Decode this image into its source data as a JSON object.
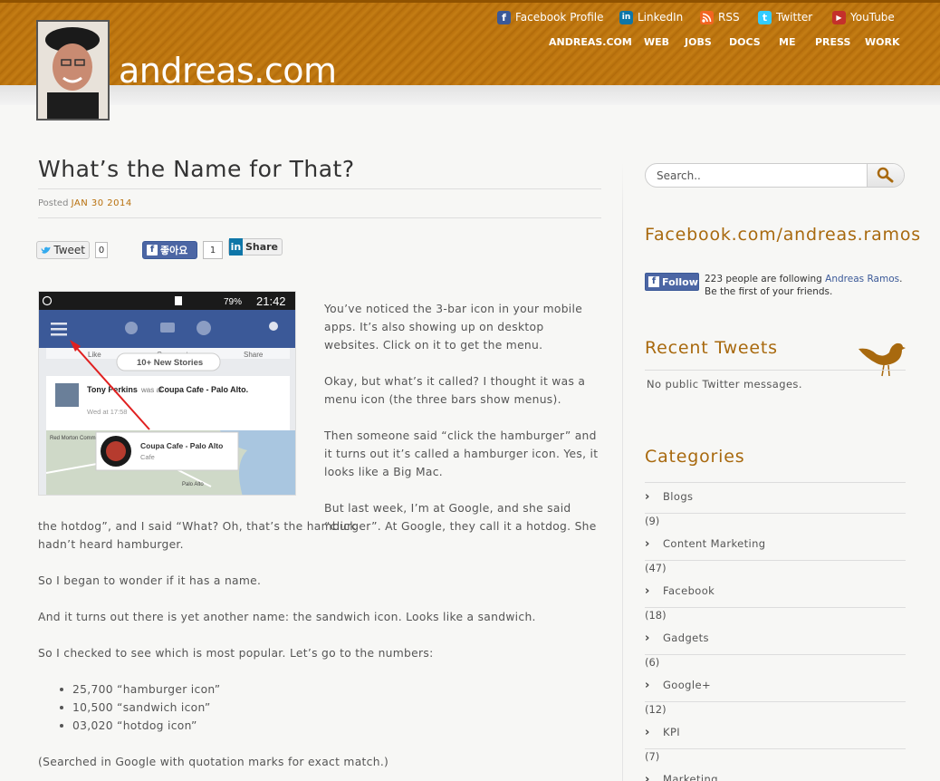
{
  "header": {
    "site_title": "andreas.com",
    "social": [
      {
        "label": "Facebook Profile",
        "icon": "facebook-icon",
        "color": "#3b5998"
      },
      {
        "label": "LinkedIn",
        "icon": "linkedin-icon",
        "color": "#0e76a8"
      },
      {
        "label": "RSS",
        "icon": "rss-icon",
        "color": "#f26522"
      },
      {
        "label": "Twitter",
        "icon": "twitter-icon",
        "color": "#33ccff"
      },
      {
        "label": "YouTube",
        "icon": "youtube-icon",
        "color": "#c4302b"
      }
    ],
    "nav": [
      "ANDREAS.COM",
      "WEB",
      "JOBS",
      "DOCS",
      "ME",
      "PRESS",
      "WORK"
    ]
  },
  "post": {
    "title": "What’s the Name for That?",
    "posted_label": "Posted",
    "date": "JAN 30 2014",
    "share": {
      "tweet_label": "Tweet",
      "tweet_count": "0",
      "like_label": "좋아요",
      "like_count": "1",
      "linkedin_label": "Share"
    },
    "paragraphs_right": [
      "You’ve noticed the 3-bar icon in your mobile apps. It’s also showing up on desktop websites. Click on it to get the menu.",
      "Okay, but what’s it called? I thought it was a menu icon (the three bars show menus).",
      "Then someone said “click the hamburger” and it turns out it’s called a hamburger icon. Yes, it looks like a Big Mac."
    ],
    "p_hotdog_1": "But last week, I’m at Google, and she said “click",
    "p_hotdog_2": "the hotdog”, and I said “What? Oh, that’s the hamburger”. At Google, they call it a hotdog. She hadn’t heard hamburger.",
    "p_wonder": "So I began to wonder if it has a name.",
    "p_sandwich": "And it turns out there is yet another name: the sandwich icon. Looks like a sandwich.",
    "p_checked": "So I checked to see which is most popular. Let’s go to the numbers:",
    "counts": [
      "25,700 “hamburger icon”",
      "10,500 “sandwich icon”",
      "03,020 “hotdog icon”"
    ],
    "p_searched": "(Searched in Google with quotation marks for exact match.)"
  },
  "phone_screenshot": {
    "status_battery": "79%",
    "status_time": "21:42",
    "like_label": "Like",
    "comment_label": "Comment",
    "share_label": "Share",
    "new_stories": "10+ New Stories",
    "author": "Tony Perkins",
    "was_at": "was at",
    "place": "Coupa Cafe - Palo Alto.",
    "time": "Wed at 17:58",
    "card_title": "Coupa Cafe - Palo Alto",
    "card_sub": "Cafe",
    "map_label_1": "Red Morton Community Park",
    "map_label_2": "Palo Alto"
  },
  "sidebar": {
    "search_placeholder": "Search..",
    "facebook_heading": "Facebook.com/andreas.ramos",
    "follow_label": "Follow",
    "fb_text_1": "223 people are following ",
    "fb_link": "Andreas Ramos",
    "fb_text_2": ". Be the first of your friends.",
    "tweets_heading": "Recent Tweets",
    "tweets_empty": "No public Twitter messages.",
    "categories_heading": "Categories",
    "categories": [
      {
        "name": "Blogs",
        "count": "(9)"
      },
      {
        "name": "Content Marketing",
        "count": "(47)"
      },
      {
        "name": "Facebook",
        "count": "(18)"
      },
      {
        "name": "Gadgets",
        "count": "(6)"
      },
      {
        "name": "Google+",
        "count": "(12)"
      },
      {
        "name": "KPI",
        "count": "(7)"
      },
      {
        "name": "Marketing",
        "count": ""
      }
    ]
  },
  "colors": {
    "accent": "#b8700d",
    "heading": "#a8690e",
    "facebook": "#3b5998"
  }
}
